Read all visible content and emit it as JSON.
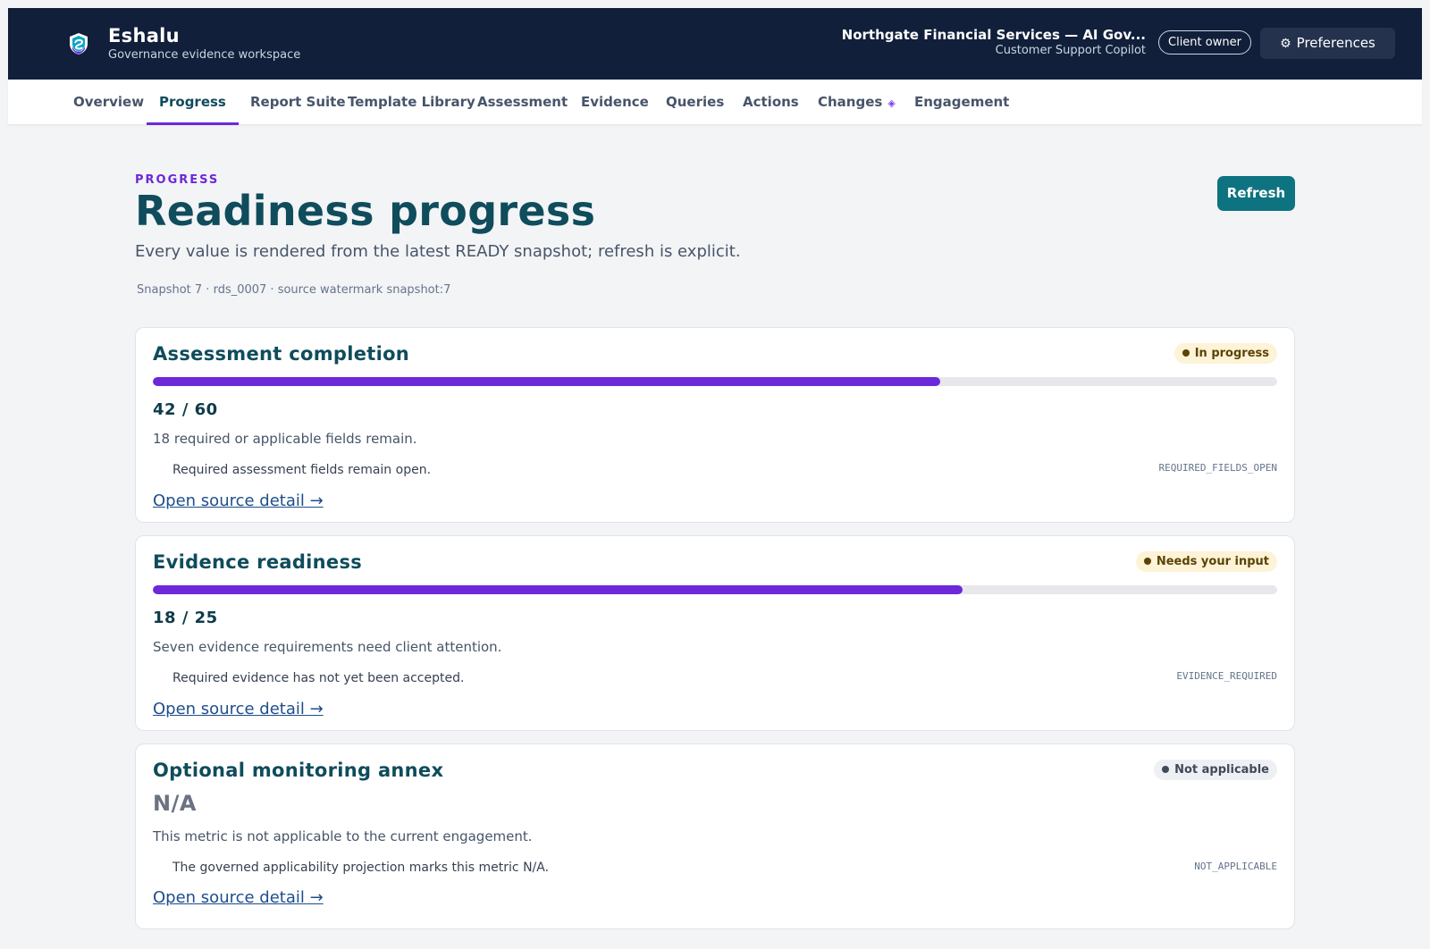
{
  "header": {
    "brand_name": "Eshalu",
    "brand_subtitle": "Governance evidence workspace",
    "client_name": "Northgate Financial Services — AI Gov...",
    "client_product": "Customer Support Copilot",
    "role_label": "Client owner",
    "preferences_label": "Preferences",
    "preferences_icon": "gear-icon",
    "colors": {
      "bar": "#111f3a",
      "logo_accent": "#6d28d9"
    }
  },
  "nav": {
    "tabs": [
      {
        "label": "Overview"
      },
      {
        "label": "Progress",
        "active": true
      },
      {
        "label": "Report Suite"
      },
      {
        "label": "Template Library"
      },
      {
        "label": "Assessment"
      },
      {
        "label": "Evidence"
      },
      {
        "label": "Queries"
      },
      {
        "label": "Actions"
      },
      {
        "label": "Changes",
        "marker": "◈"
      },
      {
        "label": "Engagement"
      }
    ]
  },
  "page": {
    "eyebrow": "PROGRESS",
    "title": "Readiness progress",
    "description": "Every value is rendered from the latest READY snapshot; refresh is explicit.",
    "snapshot_meta": "Snapshot 7 · rds_0007 · source watermark snapshot:7",
    "refresh_label": "Refresh"
  },
  "metrics": [
    {
      "title": "Assessment completion",
      "status": "In progress",
      "status_tone": "amber",
      "value": "42 / 60",
      "progress": 0.7,
      "summary": "18 required or applicable fields remain.",
      "reason": "Required assessment fields remain open.",
      "reason_code": "REQUIRED_FIELDS_OPEN",
      "link_label": "Open source detail →"
    },
    {
      "title": "Evidence readiness",
      "status": "Needs your input",
      "status_tone": "amber",
      "value": "18 / 25",
      "progress": 0.72,
      "summary": "Seven evidence requirements need client attention.",
      "reason": "Required evidence has not yet been accepted.",
      "reason_code": "EVIDENCE_REQUIRED",
      "link_label": "Open source detail →"
    },
    {
      "title": "Optional monitoring annex",
      "status": "Not applicable",
      "status_tone": "gray",
      "value": "N/A",
      "summary": "This metric is not applicable to the current engagement.",
      "reason": "The governed applicability projection marks this metric N/A.",
      "reason_code": "NOT_APPLICABLE",
      "link_label": "Open source detail →"
    }
  ],
  "colors": {
    "accent_purple": "#6d28d9",
    "title_teal": "#0f4c5c",
    "refresh_teal": "#0e7380"
  }
}
